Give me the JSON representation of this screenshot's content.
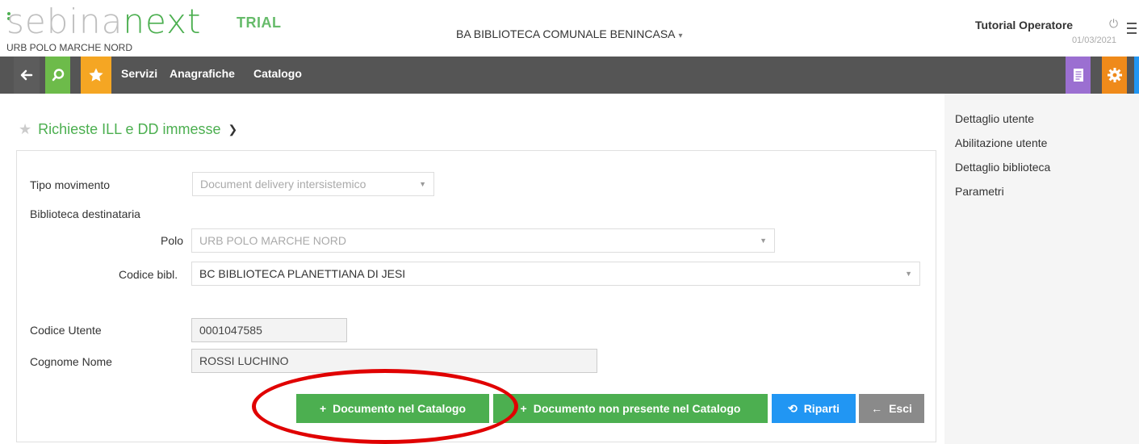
{
  "header": {
    "logo_part1": "sebina",
    "logo_part2": "next",
    "polo_sub": "URB POLO MARCHE NORD",
    "trial": "TRIAL",
    "library": "BA BIBLIOTECA COMUNALE BENINCASA",
    "operator": "Tutorial Operatore",
    "date": "01/03/2021"
  },
  "toolbar": {
    "menu": [
      "Servizi",
      "Anagrafiche",
      "Catalogo"
    ]
  },
  "page": {
    "title": "Richieste ILL e DD immesse"
  },
  "form": {
    "tipo_movimento_label": "Tipo movimento",
    "tipo_movimento_value": "Document delivery intersistemico",
    "biblioteca_destinataria_label": "Biblioteca destinataria",
    "polo_label": "Polo",
    "polo_value": "URB POLO MARCHE NORD",
    "codice_bibl_label": "Codice bibl.",
    "codice_bibl_value": "BC BIBLIOTECA PLANETTIANA DI JESI",
    "codice_utente_label": "Codice Utente",
    "codice_utente_value": "0001047585",
    "cognome_nome_label": "Cognome Nome",
    "cognome_nome_value": "ROSSI LUCHINO"
  },
  "buttons": {
    "documento_catalogo": "Documento nel Catalogo",
    "documento_non_presente": "Documento non presente nel Catalogo",
    "riparti": "Riparti",
    "esci": "Esci"
  },
  "side_links": [
    "Dettaglio utente",
    "Abilitazione utente",
    "Dettaglio biblioteca",
    "Parametri"
  ],
  "colors": {
    "brand_green": "#4caf50",
    "toolbar_bg": "#555555",
    "accent_blue": "#2196f3",
    "highlight_red": "#e00000"
  }
}
